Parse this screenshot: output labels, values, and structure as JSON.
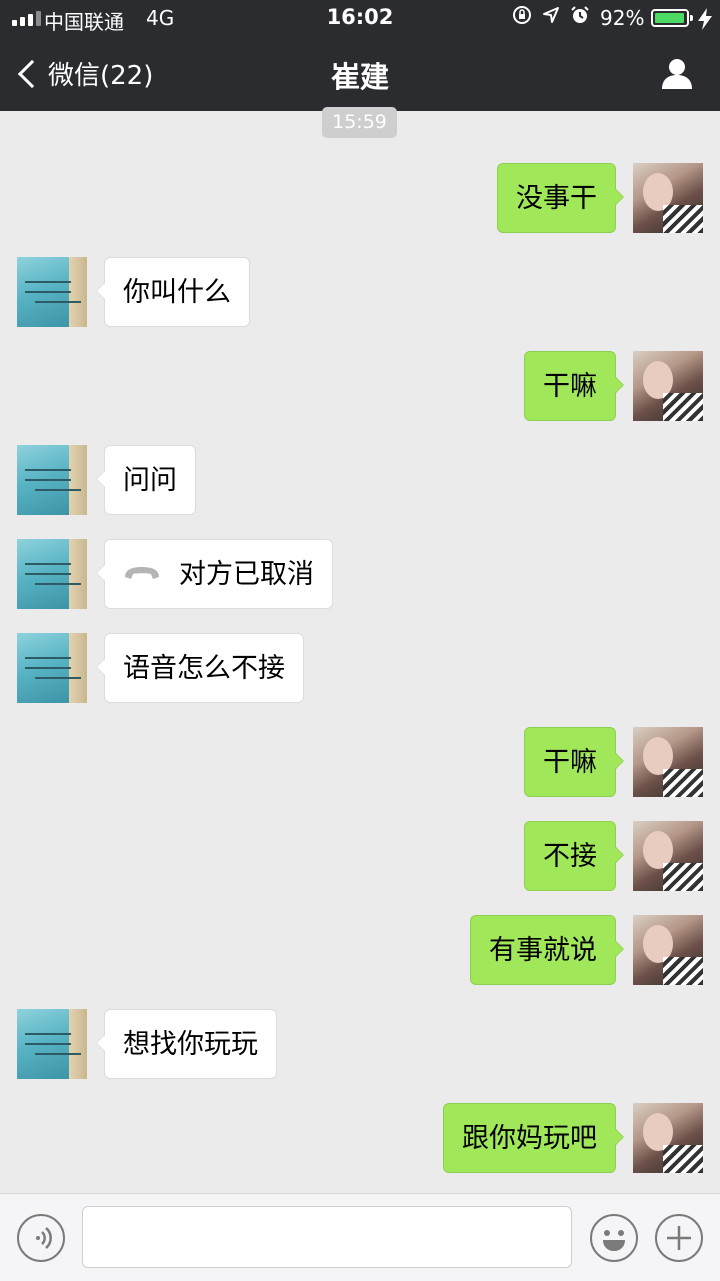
{
  "status_bar": {
    "carrier": "中国联通",
    "network": "4G",
    "time": "16:02",
    "battery_percent_label": "92%",
    "battery_level": 0.92,
    "icons": [
      "signal-icon",
      "orientation-lock-icon",
      "location-arrow-icon",
      "alarm-icon",
      "battery-icon",
      "charging-bolt-icon"
    ]
  },
  "nav": {
    "back_label": "微信(22)",
    "title": "崔建",
    "right_icon": "profile-icon"
  },
  "chat": {
    "timestamp": "15:59",
    "messages": [
      {
        "from": "me",
        "text": "没事干"
      },
      {
        "from": "them",
        "text": "你叫什么"
      },
      {
        "from": "me",
        "text": "干嘛"
      },
      {
        "from": "them",
        "text": "问问"
      },
      {
        "from": "them",
        "type": "call",
        "icon": "phone-hangup-icon",
        "text": "对方已取消"
      },
      {
        "from": "them",
        "text": "语音怎么不接"
      },
      {
        "from": "me",
        "text": "干嘛"
      },
      {
        "from": "me",
        "text": "不接"
      },
      {
        "from": "me",
        "text": "有事就说"
      },
      {
        "from": "them",
        "text": "想找你玩玩"
      },
      {
        "from": "me",
        "text": "跟你妈玩吧"
      }
    ]
  },
  "input_bar": {
    "value": "",
    "icons": [
      "voice-icon",
      "emoji-icon",
      "plus-icon"
    ]
  },
  "colors": {
    "nav_bg": "#2b2c30",
    "chat_bg": "#ebebeb",
    "my_bubble": "#a0e75a",
    "their_bubble": "#ffffff",
    "battery_fill": "#4cd964"
  }
}
